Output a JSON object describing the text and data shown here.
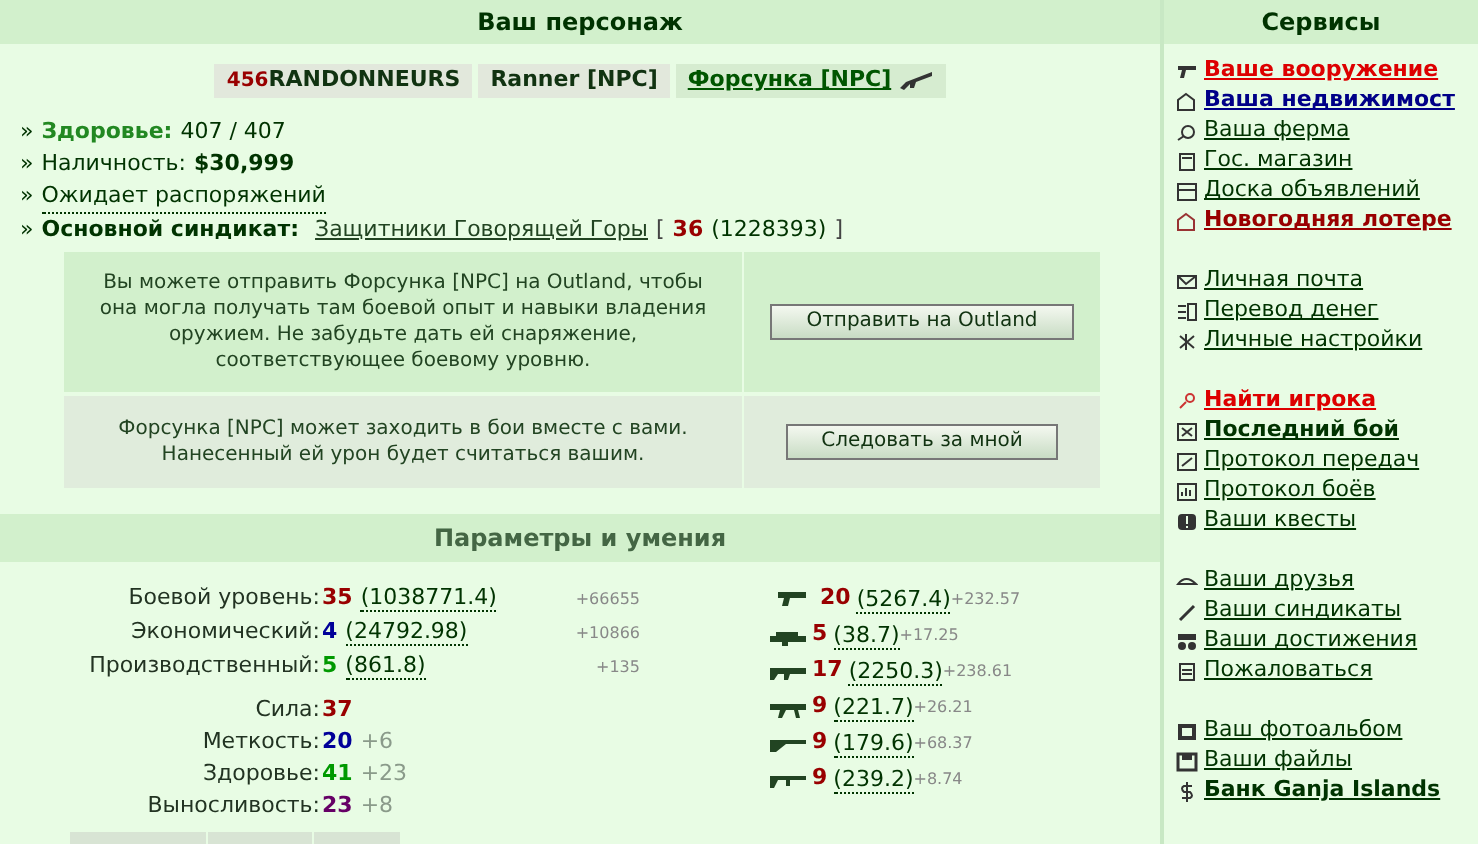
{
  "character_panel": {
    "title": "Ваш персонаж",
    "tabs": [
      {
        "badge": "456",
        "label": "RANDONNEURS",
        "selected": false
      },
      {
        "label": "Ranner [NPC]",
        "selected": false
      },
      {
        "label": "Форсунка [NPC]",
        "selected": true
      }
    ],
    "info": [
      {
        "marker": "»",
        "label": "Здоровье:",
        "value": "407 / 407",
        "kind": "health"
      },
      {
        "marker": "»",
        "label": "Наличность:",
        "value": "$30,999",
        "kind": "money"
      },
      {
        "marker": "»",
        "label": "Ожидает распоряжений",
        "kind": "link"
      },
      {
        "marker": "»",
        "label": "Основной синдикат:",
        "link": "Защитники Говорящей Горы",
        "open": "[",
        "level": "36",
        "points": "(1228393)",
        "close": "]",
        "kind": "syndicate"
      }
    ],
    "actions": [
      {
        "text": "Вы можете отправить Форсунка [NPC] на Outland, чтобы она могла получать там боевой опыт и навыки владения оружием. Не забудьте дать ей снаряжение, соответствующее боевому уровню.",
        "button": "Отправить на Outland"
      },
      {
        "text": "Форсунка [NPC] может заходить в бои вместе с вами. Нанесенный ей урон будет считаться вашим.",
        "button": "Следовать за мной"
      }
    ]
  },
  "skills_panel": {
    "title": "Параметры и умения",
    "levels": [
      {
        "label": "Боевой уровень:",
        "value": "35",
        "color": "#990000",
        "exp": "(1038771.4)",
        "gain": "+66655"
      },
      {
        "label": "Экономический:",
        "value": "4",
        "color": "#000099",
        "exp": "(24792.98)",
        "gain": "+10866"
      },
      {
        "label": "Производственный:",
        "value": "5",
        "color": "#009900",
        "exp": "(861.8)",
        "gain": "+135"
      }
    ],
    "stats": [
      {
        "label": "Сила:",
        "value": "37",
        "color": "#990000"
      },
      {
        "label": "Меткость:",
        "value": "20",
        "color": "#000099",
        "bonus": "+6"
      },
      {
        "label": "Здоровье:",
        "value": "41",
        "color": "#009900",
        "bonus": "+23"
      },
      {
        "label": "Выносливость:",
        "value": "23",
        "color": "#660066",
        "bonus": "+8"
      }
    ],
    "weapons": [
      {
        "value": "20",
        "exp": "(5267.4)",
        "gain": "+232.57"
      },
      {
        "value": "5",
        "exp": "(38.7)",
        "gain": "+17.25"
      },
      {
        "value": "17",
        "exp": "(2250.3)",
        "gain": "+238.61"
      },
      {
        "value": "9",
        "exp": "(221.7)",
        "gain": "+26.21"
      },
      {
        "value": "9",
        "exp": "(179.6)",
        "gain": "+68.37"
      },
      {
        "value": "9",
        "exp": "(239.2)",
        "gain": "+8.74"
      }
    ]
  },
  "services_panel": {
    "title": "Сервисы",
    "groups": [
      [
        {
          "label": "Ваше вооружение",
          "kind": "red"
        },
        {
          "label": "Ваша недвижимост",
          "kind": "blue"
        },
        {
          "label": "Ваша ферма",
          "kind": "plain"
        },
        {
          "label": "Гос. магазин",
          "kind": "plain"
        },
        {
          "label": "Доска объявлений",
          "kind": "plain"
        },
        {
          "label": "Новогодняя лотере",
          "kind": "darkred"
        }
      ],
      [
        {
          "label": "Личная почта",
          "kind": "plain"
        },
        {
          "label": "Перевод денег",
          "kind": "plain"
        },
        {
          "label": "Личные настройки",
          "kind": "plain"
        }
      ],
      [
        {
          "label": "Найти игрока",
          "kind": "red"
        },
        {
          "label": "Последний бой",
          "kind": "bold"
        },
        {
          "label": "Протокол передач",
          "kind": "plain"
        },
        {
          "label": "Протокол боёв",
          "kind": "plain"
        },
        {
          "label": "Ваши квесты",
          "kind": "plain"
        }
      ],
      [
        {
          "label": "Ваши друзья",
          "kind": "plain"
        },
        {
          "label": "Ваши синдикаты",
          "kind": "plain"
        },
        {
          "label": "Ваши достижения",
          "kind": "plain"
        },
        {
          "label": "Пожаловаться",
          "kind": "plain"
        }
      ],
      [
        {
          "label": "Ваш фотоальбом",
          "kind": "plain"
        },
        {
          "label": "Ваши файлы",
          "kind": "plain"
        },
        {
          "label": "Банк Ganja Islands",
          "kind": "bold"
        }
      ]
    ]
  }
}
